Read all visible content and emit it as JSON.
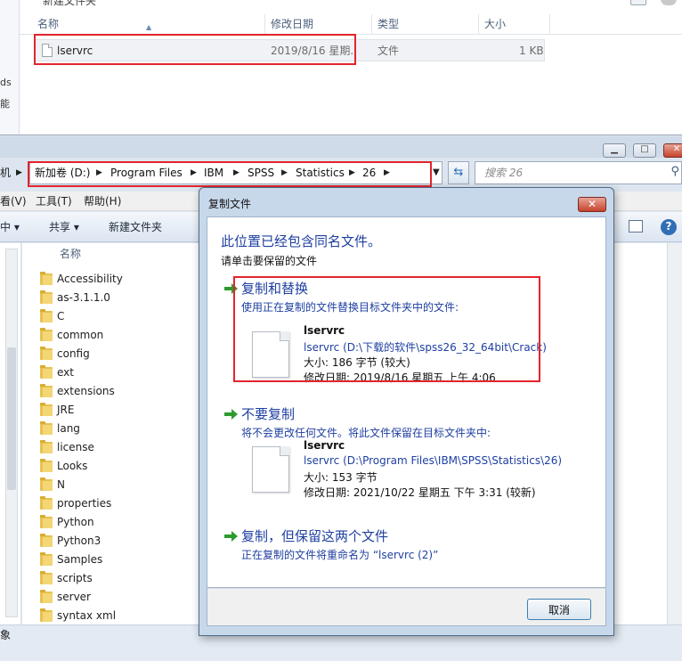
{
  "top_window": {
    "cut_title": "新建文件夹",
    "left_strip_fragments": [
      "ds",
      "能"
    ],
    "columns": {
      "name": "名称",
      "date": "修改日期",
      "type": "类型",
      "size": "大小"
    },
    "file": {
      "name": "lservrc",
      "date": "2019/8/16 星期..",
      "type": "文件",
      "size": "1 KB"
    }
  },
  "main_window": {
    "breadcrumb_prefix": "机",
    "breadcrumbs": [
      "新加卷 (D:)",
      "Program Files",
      "IBM",
      "SPSS",
      "Statistics",
      "26"
    ],
    "search_placeholder": "搜索 26",
    "menu": [
      "看(V)",
      "工具(T)",
      "帮助(H)"
    ],
    "toolbar": {
      "left_cut": "中 ▾",
      "share": "共享 ▾",
      "new_folder": "新建文件夹"
    },
    "name_header": "名称",
    "folders": [
      "Accessibility",
      "as-3.1.1.0",
      "C",
      "common",
      "config",
      "ext",
      "extensions",
      "JRE",
      "lang",
      "license",
      "Looks",
      "N",
      "properties",
      "Python",
      "Python3",
      "Samples",
      "scripts",
      "server",
      "syntax xml"
    ],
    "status_text": "象"
  },
  "dialog": {
    "title": "复制文件",
    "heading": "此位置已经包含同名文件。",
    "subheading": "请单击要保留的文件",
    "options": [
      {
        "title": "复制和替换",
        "desc": "使用正在复制的文件替换目标文件夹中的文件:",
        "file_name": "lservrc",
        "file_path": "lservrc (D:\\下载的软件\\spss26_32_64bit\\Crack)",
        "file_size": "大小: 186 字节 (较大)",
        "file_date": "修改日期: 2019/8/16 星期五 上午 4:06"
      },
      {
        "title": "不要复制",
        "desc": "将不会更改任何文件。将此文件保留在目标文件夹中:",
        "file_name": "lservrc",
        "file_path": "lservrc (D:\\Program Files\\IBM\\SPSS\\Statistics\\26)",
        "file_size": "大小: 153 字节",
        "file_date": "修改日期: 2021/10/22 星期五 下午 3:31 (较新)"
      },
      {
        "title": "复制，但保留这两个文件",
        "desc": "正在复制的文件将重命名为 “lservrc (2)”"
      }
    ],
    "cancel_label": "取消"
  },
  "colors": {
    "highlight_red": "#e3242b",
    "link_blue": "#1e3fa0",
    "arrow_green": "#2e9b2e"
  }
}
